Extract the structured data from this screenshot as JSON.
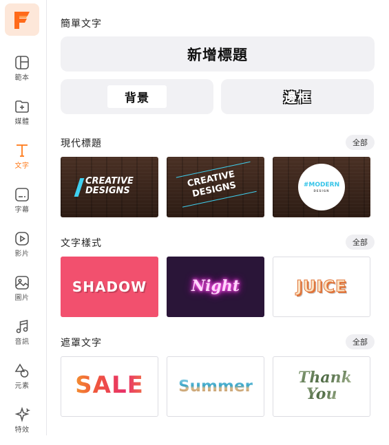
{
  "sidebar": {
    "logo_letter": "F",
    "items": [
      {
        "label": "範本",
        "icon": "template-icon"
      },
      {
        "label": "媒體",
        "icon": "folder-plus-icon"
      },
      {
        "label": "文字",
        "icon": "text-icon",
        "active": true
      },
      {
        "label": "字幕",
        "icon": "subtitle-icon"
      },
      {
        "label": "影片",
        "icon": "play-circle-icon"
      },
      {
        "label": "圖片",
        "icon": "image-icon"
      },
      {
        "label": "音訊",
        "icon": "music-note-icon"
      },
      {
        "label": "元素",
        "icon": "shapes-icon"
      },
      {
        "label": "特效",
        "icon": "sparkle-icon"
      }
    ]
  },
  "simple_text": {
    "title": "簡單文字",
    "add_title_label": "新增標題",
    "background_label": "背景",
    "border_label": "邊框"
  },
  "modern_titles": {
    "title": "現代標題",
    "all_label": "全部",
    "cards": [
      {
        "line1": "CREATIVE",
        "line2": "DESIGNS"
      },
      {
        "line1": "CREATIVE",
        "line2": "DESIGNS"
      },
      {
        "line1": "#MODERN",
        "line2": "DESIGN"
      }
    ]
  },
  "text_styles": {
    "title": "文字樣式",
    "all_label": "全部",
    "cards": [
      {
        "text": "SHADOW"
      },
      {
        "text": "Night"
      },
      {
        "text": "JUICE"
      }
    ]
  },
  "masked_text": {
    "title": "遮罩文字",
    "all_label": "全部",
    "cards": [
      {
        "text": "SALE"
      },
      {
        "text": "Summer"
      },
      {
        "line1": "Thank",
        "line2": "You"
      }
    ]
  },
  "colors": {
    "accent": "#ff7a1a",
    "shadow_card_bg": "#f2506e",
    "night_card_bg": "#2a1538",
    "neon": "#ff6bf0"
  }
}
